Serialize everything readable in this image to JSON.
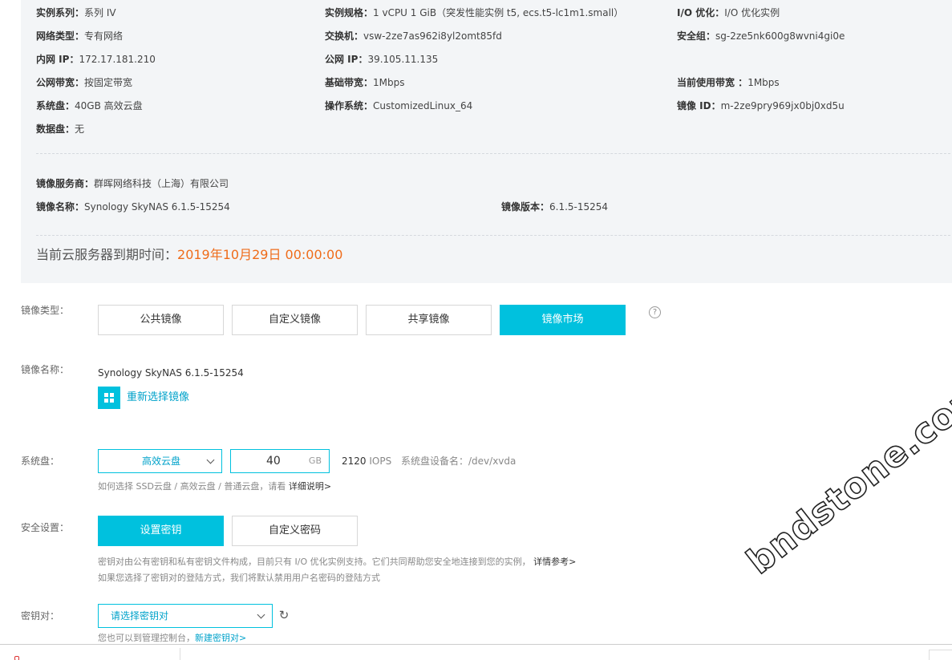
{
  "instance_info": {
    "series": {
      "label": "实例系列：",
      "value": "系列 IV"
    },
    "spec": {
      "label": "实例规格：",
      "value": "1 vCPU 1 GiB（突发性能实例 t5, ecs.t5-lc1m1.small）"
    },
    "io_opt": {
      "label": "I/O 优化：",
      "value": "I/O 优化实例"
    },
    "network_type": {
      "label": "网络类型：",
      "value": "专有网络"
    },
    "vswitch": {
      "label": "交换机：",
      "value": "vsw-2ze7as962i8yl2omt85fd"
    },
    "security_group": {
      "label": "安全组：",
      "value": "sg-2ze5nk600g8wvni4gi0e"
    },
    "private_ip": {
      "label": "内网 IP：",
      "value": "172.17.181.210"
    },
    "public_ip": {
      "label": "公网 IP：",
      "value": "39.105.11.135"
    },
    "public_bandwidth": {
      "label": "公网带宽：",
      "value": "按固定带宽"
    },
    "base_bandwidth": {
      "label": "基础带宽：",
      "value": "1Mbps"
    },
    "current_bandwidth": {
      "label": "当前使用带宽 ：",
      "value": "1Mbps"
    },
    "system_disk": {
      "label": "系统盘：",
      "value": "40GB 高效云盘"
    },
    "os": {
      "label": "操作系统：",
      "value": "CustomizedLinux_64"
    },
    "image_id": {
      "label": "镜像 ID：",
      "value": "m-2ze9pry969jx0bj0xd5u"
    },
    "data_disk": {
      "label": "数据盘：",
      "value": "无"
    },
    "image_provider": {
      "label": "镜像服务商：",
      "value": "群晖网络科技（上海）有限公司"
    },
    "image_name": {
      "label": "镜像名称：",
      "value": "Synology SkyNAS 6.1.5-15254"
    },
    "image_version": {
      "label": "镜像版本：",
      "value": "6.1.5-15254"
    },
    "expire": {
      "label": "当前云服务器到期时间：",
      "value": "2019年10月29日 00:00:00"
    }
  },
  "form": {
    "image_type": {
      "label": "镜像类型：",
      "options": [
        "公共镜像",
        "自定义镜像",
        "共享镜像",
        "镜像市场"
      ],
      "selected": "镜像市场",
      "help_icon": "?"
    },
    "image_name": {
      "label": "镜像名称：",
      "value": "Synology SkyNAS 6.1.5-15254",
      "reselect": "重新选择镜像",
      "reselect_icon": "grid-icon"
    },
    "system_disk": {
      "label": "系统盘：",
      "type": "高效云盘",
      "size": "40",
      "unit": "GB",
      "iops_value": "2120",
      "iops_unit": "IOPS",
      "device_label": "系统盘设备名：/dev/xvda",
      "hint": "如何选择 SSD云盘 / 高效云盘 / 普通云盘，请看",
      "hint_link": "详细说明>"
    },
    "security": {
      "label": "安全设置：",
      "options": [
        "设置密钥",
        "自定义密码"
      ],
      "selected": "设置密钥",
      "hint1": "密钥对由公有密钥和私有密钥文件构成，目前只有 I/O 优化实例支持。它们共同帮助您安全地连接到您的实例，",
      "hint1_link": "详情参考>",
      "hint2": "如果您选择了密钥对的登陆方式，我们将默认禁用用户名密码的登陆方式"
    },
    "keypair": {
      "label": "密钥对：",
      "placeholder": "请选择密钥对",
      "refresh_icon": "refresh-icon",
      "hint": "您也可以到管理控制台，",
      "hint_link": "新建密钥对>"
    }
  },
  "watermark": "bndstone.com",
  "colors": {
    "accent": "#00c1de",
    "link": "#00a2ca",
    "date": "#ef6c1a",
    "panel": "#f3f5f7"
  }
}
